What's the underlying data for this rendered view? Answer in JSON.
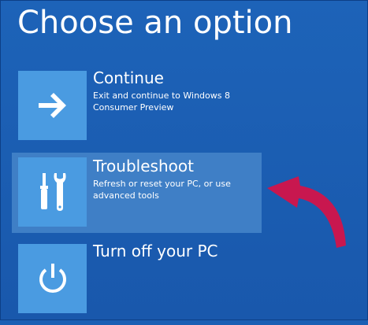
{
  "title": "Choose an option",
  "options": [
    {
      "label": "Continue",
      "description": "Exit and continue to Windows 8 Consumer Preview",
      "icon": "arrow-right-icon"
    },
    {
      "label": "Troubleshoot",
      "description": "Refresh or reset your PC, or use advanced tools",
      "icon": "tools-icon"
    },
    {
      "label": "Turn off your PC",
      "description": "",
      "icon": "power-icon"
    }
  ],
  "colors": {
    "background": "#1a5fb4",
    "tile": "#4a9be1",
    "highlight": "#3f7fc6",
    "callout_arrow": "#c8174f"
  }
}
